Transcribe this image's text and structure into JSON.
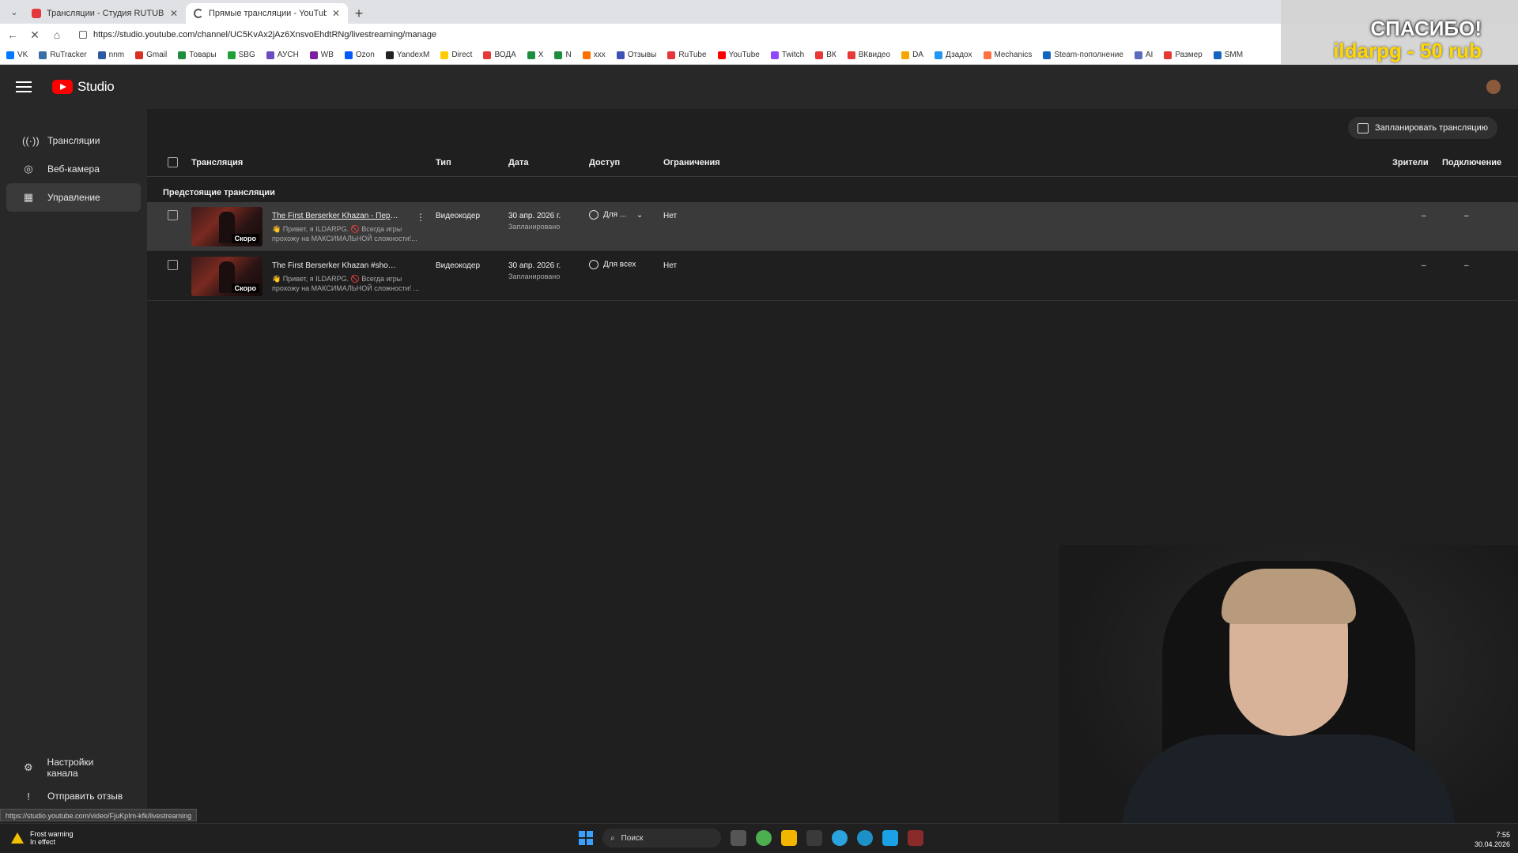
{
  "browser": {
    "tabs": [
      {
        "title": "Трансляции - Студия RUTUBE",
        "active": false,
        "favicon_color": "#e5363c"
      },
      {
        "title": "Прямые трансляции - YouTube St",
        "active": true,
        "favicon_color": "#555555"
      }
    ],
    "url": "https://studio.youtube.com/channel/UC5KvAx2jAz6XnsvoEhdtRNg/livestreaming/manage",
    "bookmarks": [
      {
        "label": "VK",
        "color": "#0077ff"
      },
      {
        "label": "RuTracker",
        "color": "#3b6ea5"
      },
      {
        "label": "nnm",
        "color": "#2d5aa0"
      },
      {
        "label": "Gmail",
        "color": "#d93025"
      },
      {
        "label": "Товары",
        "color": "#1e8e3e"
      },
      {
        "label": "SBG",
        "color": "#21a038"
      },
      {
        "label": "АУСН",
        "color": "#6c4cc1"
      },
      {
        "label": "WB",
        "color": "#7b1fa2"
      },
      {
        "label": "Ozon",
        "color": "#005bff"
      },
      {
        "label": "YandexM",
        "color": "#222222"
      },
      {
        "label": "Direct",
        "color": "#ffcc00"
      },
      {
        "label": "ВОДА",
        "color": "#e53935"
      },
      {
        "label": "X",
        "color": "#1e8e3e"
      },
      {
        "label": "N",
        "color": "#1e8e3e"
      },
      {
        "label": "xxx",
        "color": "#ff6f00"
      },
      {
        "label": "Отзывы",
        "color": "#3f51b5"
      },
      {
        "label": "RuTube",
        "color": "#e5363c"
      },
      {
        "label": "YouTube",
        "color": "#ff0000"
      },
      {
        "label": "Twitch",
        "color": "#9146ff"
      },
      {
        "label": "ВК",
        "color": "#e53935"
      },
      {
        "label": "ВКвидео",
        "color": "#e53935"
      },
      {
        "label": "DA",
        "color": "#f7a600"
      },
      {
        "label": "Дзадох",
        "color": "#2196f3"
      },
      {
        "label": "Mechanics",
        "color": "#ff7043"
      },
      {
        "label": "Steam-пополнение",
        "color": "#1565c0"
      },
      {
        "label": "AI",
        "color": "#5c6bc0"
      },
      {
        "label": "Размер",
        "color": "#e53935"
      },
      {
        "label": "SMM",
        "color": "#1565c0"
      }
    ]
  },
  "overlay": {
    "thanks": "СПАСИБО!",
    "donation": "ildarpg - 50 rub"
  },
  "studio": {
    "logo_text": "Studio",
    "sidebar": {
      "items": [
        {
          "label": "Трансляции",
          "icon": "broadcast-icon",
          "active": false
        },
        {
          "label": "Веб-камера",
          "icon": "camera-icon",
          "active": false
        },
        {
          "label": "Управление",
          "icon": "calendar-icon",
          "active": true
        }
      ],
      "bottom": [
        {
          "label": "Настройки канала",
          "icon": "gear-icon"
        },
        {
          "label": "Отправить отзыв",
          "icon": "feedback-icon"
        }
      ]
    },
    "schedule_button": "Запланировать трансляцию",
    "table": {
      "headers": {
        "stream": "Трансляция",
        "type": "Тип",
        "date": "Дата",
        "access": "Доступ",
        "restrictions": "Ограничения",
        "viewers": "Зрители",
        "connection": "Подключение"
      },
      "section": "Предстоящие трансляции",
      "rows": [
        {
          "title": "The First Berserker Khazan - Перв...",
          "description": "👋 Привет, я ILDARPG. 🚫 Всегда игры прохожу на МАКСИМАЛЬНОЙ сложности!...",
          "badge": "Скоро",
          "type": "Видеокодер",
          "date": "30 апр. 2026 г.",
          "status": "Запланировано",
          "access": "Для ...",
          "restrictions": "Нет",
          "viewers": "–",
          "connection": "–"
        },
        {
          "title": "The First Berserker Khazan #short...",
          "description": "👋 Привет, я ILDARPG. 🚫 Всегда игры прохожу на МАКСИМАЛЬНОЙ сложности! ...",
          "badge": "Скоро",
          "type": "Видеокодер",
          "date": "30 апр. 2026 г.",
          "status": "Запланировано",
          "access": "Для всех",
          "restrictions": "Нет",
          "viewers": "–",
          "connection": "–"
        }
      ]
    },
    "status_url": "https://studio.youtube.com/video/FjuKpIm-kfk/livestreaming"
  },
  "taskbar": {
    "weather_title": "Frost warning",
    "weather_sub": "In effect",
    "search_placeholder": "Поиск",
    "time": "7:55",
    "date": "30.04.2026"
  }
}
